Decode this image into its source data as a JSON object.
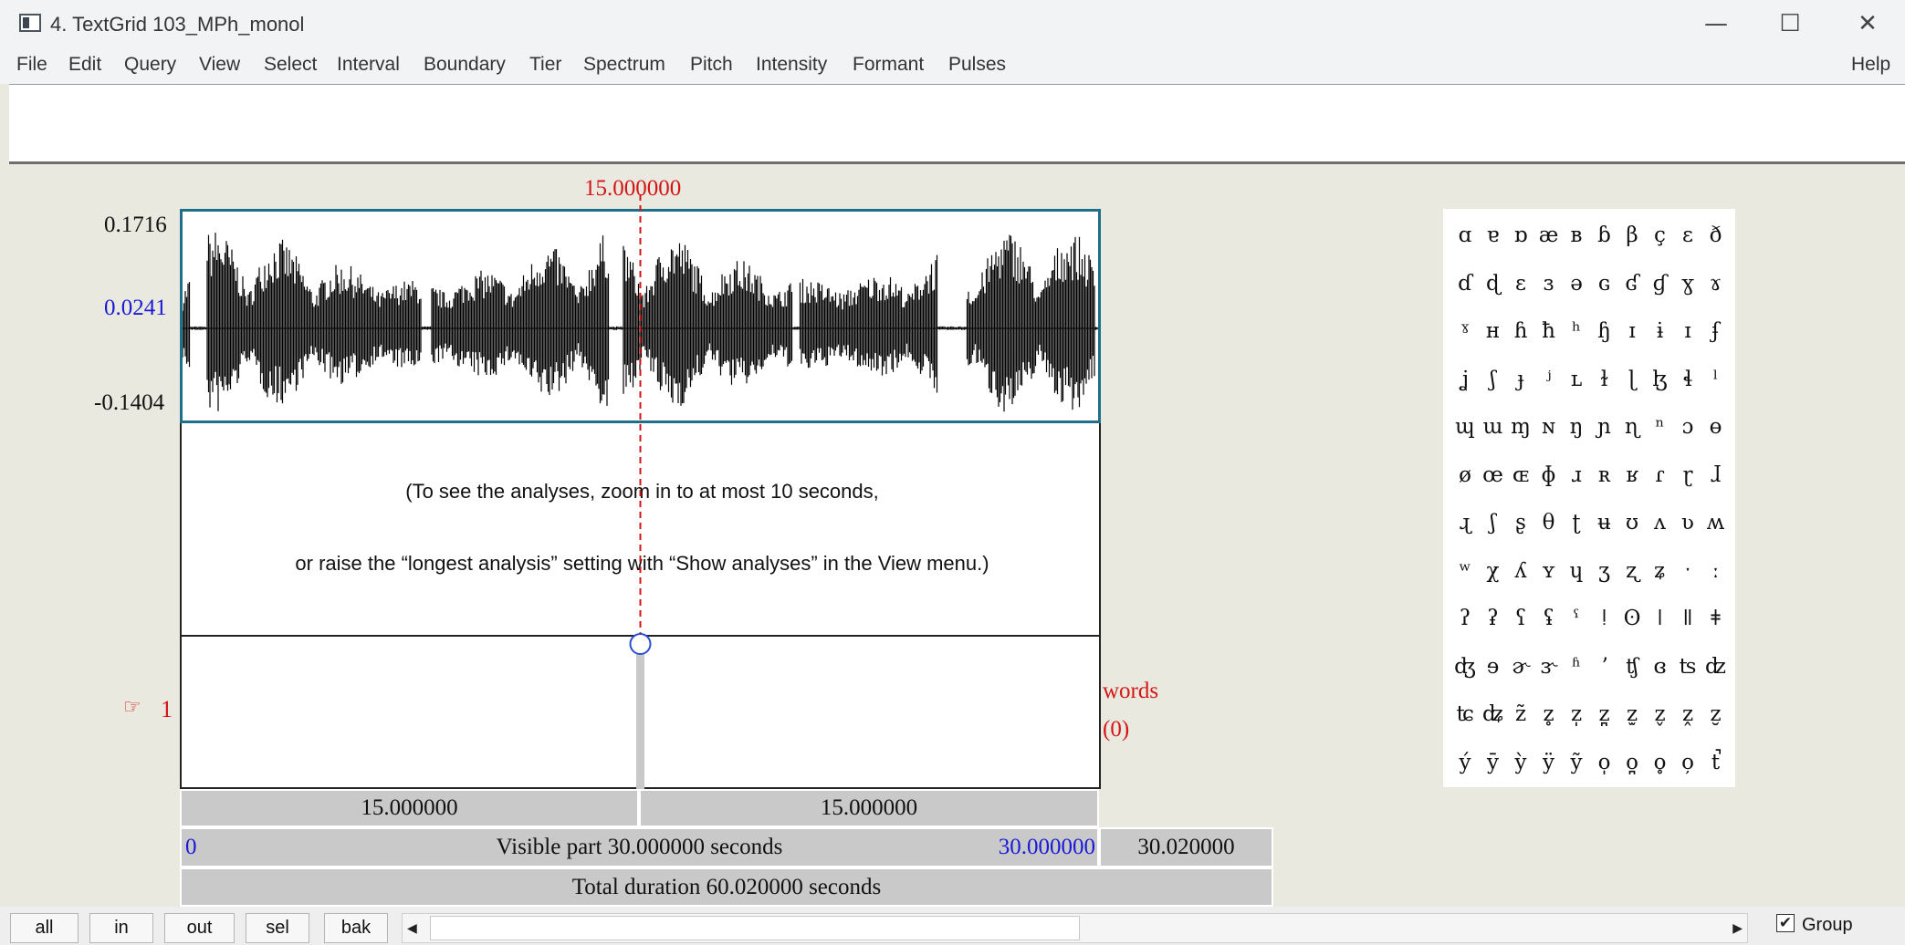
{
  "window": {
    "title": "4. TextGrid 103_MPh_monol",
    "icons": [
      "minimize-icon",
      "maximize-icon",
      "close-icon"
    ],
    "minimize_glyph": "—",
    "maximize_glyph": "☐",
    "close_glyph": "✕"
  },
  "menu": {
    "items": [
      "File",
      "Edit",
      "Query",
      "View",
      "Select",
      "Interval",
      "Boundary",
      "Tier",
      "Spectrum",
      "Pitch",
      "Intensity",
      "Formant",
      "Pulses"
    ],
    "help": "Help"
  },
  "editor": {
    "cursor_time": "15.000000",
    "amp_max": "0.1716",
    "amp_cursor": "0.0241",
    "amp_min": "-0.1404",
    "message_line1": "(To see the analyses, zoom in to at most 10 seconds,",
    "message_line2": "or raise the “longest analysis” setting with “Show analyses” in the View menu.)",
    "cursor_fraction": 0.5
  },
  "tier": {
    "pointer": "☞",
    "number": "1",
    "name": "words",
    "count": "(0)"
  },
  "time_bars": {
    "left_segment": "15.000000",
    "right_segment": "15.000000",
    "visible_start": "0",
    "visible_label": "Visible part 30.000000 seconds",
    "visible_end": "30.000000",
    "after_visible": "30.020000",
    "total": "Total duration 60.020000 seconds"
  },
  "ipa": {
    "rows": [
      [
        "ɑ",
        "ɐ",
        "ɒ",
        "æ",
        "ʙ",
        "ɓ",
        "β",
        "ç",
        "ɛ",
        "ð"
      ],
      [
        "ɗ",
        "ɖ",
        "ɛ",
        "ɜ",
        "ə",
        "ɢ",
        "ʛ",
        "ɠ",
        "ɣ",
        "ɤ"
      ],
      [
        "ˠ",
        "ʜ",
        "ɦ",
        "ħ",
        "ʰ",
        "ɧ",
        "ɪ",
        "ɨ",
        "ɪ",
        "ʄ"
      ],
      [
        "ʝ",
        "ʃ",
        "ɟ",
        "ʲ",
        "ʟ",
        "ɫ",
        "ɭ",
        "ɮ",
        "ɬ",
        "ˡ"
      ],
      [
        "ɰ",
        "ɯ",
        "ɱ",
        "ɴ",
        "ŋ",
        "ɲ",
        "ɳ",
        "ⁿ",
        "ɔ",
        "ɵ"
      ],
      [
        "ø",
        "œ",
        "ɶ",
        "ɸ",
        "ɹ",
        "ʀ",
        "ʁ",
        "ɾ",
        "ɽ",
        "ɺ"
      ],
      [
        "ɻ",
        "ʃ",
        "ʂ",
        "θ",
        "ʈ",
        "ʉ",
        "ʊ",
        "ʌ",
        "ʋ",
        "ʍ"
      ],
      [
        "ʷ",
        "χ",
        "ʎ",
        "ʏ",
        "ɥ",
        "ʒ",
        "ʐ",
        "ʑ",
        "ˑ",
        "ː"
      ],
      [
        "ʔ",
        "ʡ",
        "ʕ",
        "ʢ",
        "ˤ",
        "ǃ",
        "ʘ",
        "ǀ",
        "ǁ",
        "ǂ"
      ],
      [
        "ʤ",
        "ɘ",
        "ɚ",
        "ɝ",
        "ʱ",
        "ʼ",
        "ʧ",
        "ɞ",
        "ʦ",
        "ʣ"
      ],
      [
        "ʨ",
        "ʥ",
        "z̃",
        "z̥",
        "z̩",
        "z̪",
        "z̫",
        "z̬",
        "z̭",
        "z̮"
      ],
      [
        "ý",
        "ȳ",
        "ỳ",
        "ÿ",
        "ỹ",
        "o̩",
        "o̪",
        "o̥",
        "o̦",
        "t̚"
      ]
    ]
  },
  "toolbar": {
    "all": "all",
    "in": "in",
    "out": "out",
    "sel": "sel",
    "bak": "bak",
    "left_arrow": "◀",
    "right_arrow": "▶",
    "group_check": "✔",
    "group_label": "Group"
  },
  "colors": {
    "cursor_red": "#d41515",
    "blue_value": "#1a1ad6",
    "wave_border": "#1e6f8a",
    "cursor_circle": "#2b4fcf"
  }
}
